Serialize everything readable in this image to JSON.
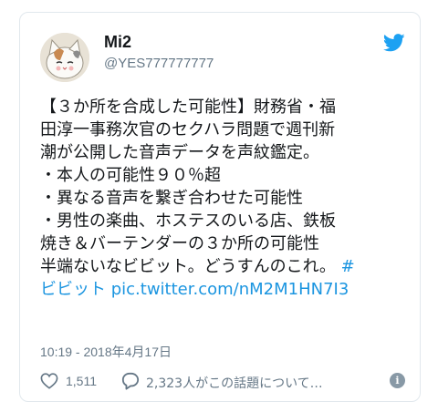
{
  "tweet": {
    "author": {
      "name": "Mi2",
      "handle": "@YES777777777"
    },
    "text_lines": [
      "【３か所を合成した可能性】財務省・福",
      "田淳一事務次官のセクハラ問題で週刊新",
      "潮が公開した音声データを声紋鑑定。",
      "・本人の可能性９０％超",
      "・異なる音声を繋ぎ合わせた可能性",
      "・男性の楽曲、ホステスのいる店、鉄板",
      "焼き＆バーテンダーの３か所の可能性",
      "半端ないなビビット。どうすんのこれ。"
    ],
    "hashtag_part1": "#",
    "hashtag_part2": "ビビット",
    "pic_link": "pic.twitter.com/nM2M1HN7I3",
    "timestamp": "10:19 - 2018年4月17日",
    "like_count": "1,511",
    "reply_text": "2,323人がこの話題について…"
  },
  "colors": {
    "link": "#1b95e0",
    "muted": "#657786",
    "border": "#e1e8ed",
    "twitter_blue": "#1da1f2"
  },
  "icons": {
    "bird": "twitter-bird-icon",
    "heart": "heart-icon",
    "reply": "reply-bubble-icon",
    "info": "info-icon"
  }
}
